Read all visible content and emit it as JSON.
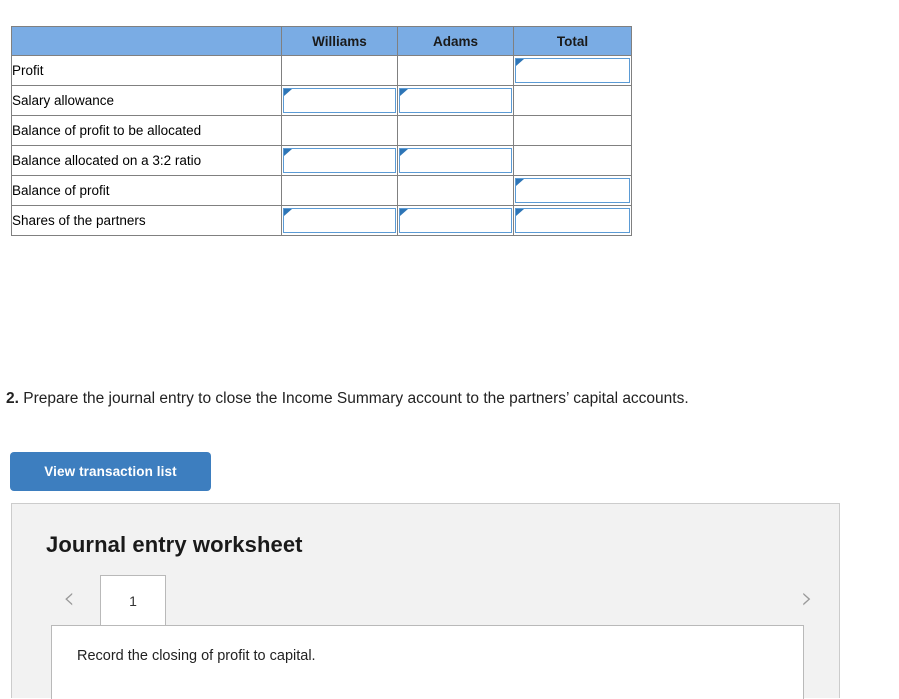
{
  "allocation_table": {
    "columns": [
      "",
      "Williams",
      "Adams",
      "Total"
    ],
    "rows": [
      {
        "label": "Profit",
        "williams": {
          "input": false,
          "value": ""
        },
        "adams": {
          "input": false,
          "value": ""
        },
        "total": {
          "input": true,
          "value": ""
        }
      },
      {
        "label": "Salary allowance",
        "williams": {
          "input": true,
          "value": ""
        },
        "adams": {
          "input": true,
          "value": ""
        },
        "total": {
          "input": false,
          "value": ""
        }
      },
      {
        "label": "Balance of profit to be allocated",
        "williams": {
          "input": false,
          "value": ""
        },
        "adams": {
          "input": false,
          "value": ""
        },
        "total": {
          "input": false,
          "value": ""
        }
      },
      {
        "label": "Balance allocated on a 3:2 ratio",
        "williams": {
          "input": true,
          "value": ""
        },
        "adams": {
          "input": true,
          "value": ""
        },
        "total": {
          "input": false,
          "value": ""
        }
      },
      {
        "label": "Balance of profit",
        "williams": {
          "input": false,
          "value": ""
        },
        "adams": {
          "input": false,
          "value": ""
        },
        "total": {
          "input": true,
          "value": ""
        }
      },
      {
        "label": "Shares of the partners",
        "williams": {
          "input": true,
          "value": ""
        },
        "adams": {
          "input": true,
          "value": ""
        },
        "total": {
          "input": true,
          "value": ""
        }
      }
    ]
  },
  "question": {
    "number": "2.",
    "text": "Prepare the journal entry to close the Income Summary account to the partners’ capital accounts."
  },
  "toolbar": {
    "view_transaction_list_label": "View transaction list"
  },
  "worksheet": {
    "title": "Journal entry worksheet",
    "prev_icon": "‹",
    "next_icon": "›",
    "tabs": [
      "1"
    ],
    "active_tab": "1",
    "note": "Record the closing of profit to capital."
  },
  "colors": {
    "header_blue": "#7AACE4",
    "input_border": "#5B9BD5",
    "input_marker": "#2E75B6",
    "button_blue": "#3D7EBF",
    "panel_gray": "#f2f2f2"
  }
}
